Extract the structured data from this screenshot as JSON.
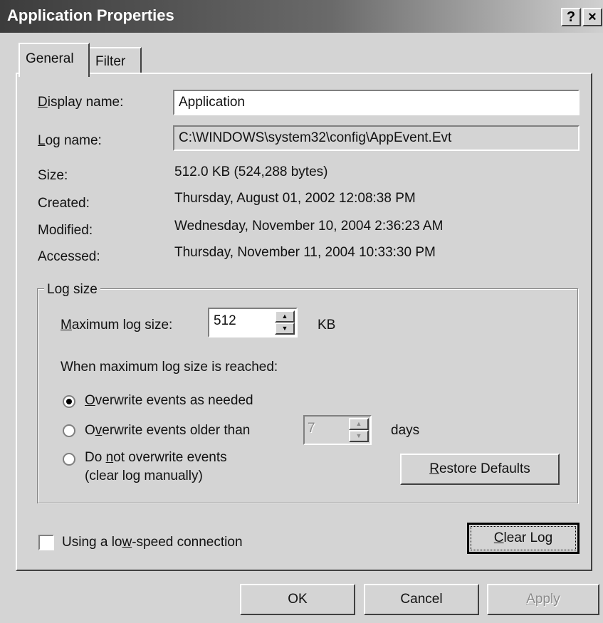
{
  "window": {
    "title": "Application Properties",
    "help_glyph": "?",
    "close_glyph": "×"
  },
  "tabs": [
    {
      "label": "General",
      "selected": true
    },
    {
      "label": "Filter",
      "selected": false
    }
  ],
  "general": {
    "display_name_label": "Display name:",
    "display_name_value": "Application",
    "log_name_label": "Log name:",
    "log_name_value": "C:\\WINDOWS\\system32\\config\\AppEvent.Evt",
    "size_label": "Size:",
    "size_value": "512.0 KB (524,288 bytes)",
    "created_label": "Created:",
    "created_value": "Thursday, August 01, 2002 12:08:38 PM",
    "modified_label": "Modified:",
    "modified_value": "Wednesday, November 10, 2004 2:36:23 AM",
    "accessed_label": "Accessed:",
    "accessed_value": "Thursday, November 11, 2004 10:33:30 PM"
  },
  "log_size": {
    "group_title": "Log size",
    "max_label": "Maximum log size:",
    "max_value": "512",
    "max_unit": "KB",
    "when_reached_label": "When maximum log size is reached:",
    "options": [
      {
        "label": "Overwrite events as needed",
        "selected": true
      },
      {
        "label": "Overwrite events older than",
        "selected": false
      },
      {
        "label": "Do not overwrite events",
        "sublabel": "(clear log manually)",
        "selected": false
      }
    ],
    "days_value": "7",
    "days_unit": "days",
    "restore_defaults_label": "Restore Defaults"
  },
  "low_speed_label": "Using a low-speed connection",
  "low_speed_checked": false,
  "clear_log_label": "Clear Log",
  "footer": {
    "ok_label": "OK",
    "cancel_label": "Cancel",
    "apply_label": "Apply"
  },
  "icons": {
    "radio_selected": "radio-filled",
    "spinner": "up-down-arrows"
  }
}
